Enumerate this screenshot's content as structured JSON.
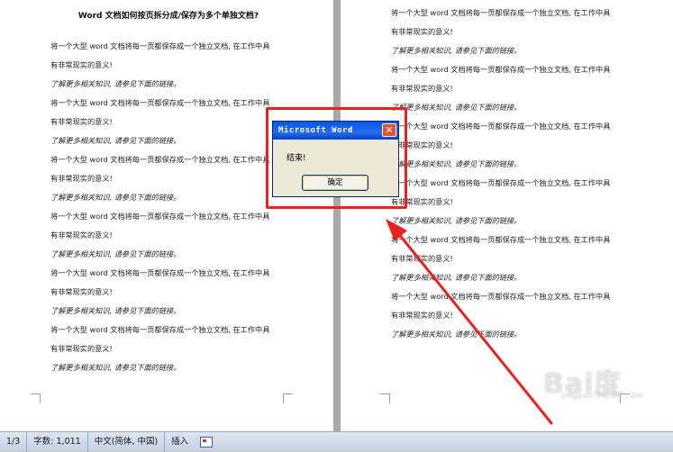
{
  "document": {
    "title": "Word 文档如何按页拆分成/保存为多个单独文档?",
    "para_line1": "将一个大型 word 文档将每一页都保存成一个独立文档, 在工作中具",
    "para_line2": "有非常现实的意义!",
    "link_line": "了解更多相关知识,  请参见下面的链接。"
  },
  "dialog": {
    "title": "Microsoft Word",
    "message": "结束!",
    "ok_label": "确定",
    "close_symbol": "✕"
  },
  "status_bar": {
    "page": "1/3",
    "word_count": "字数: 1,011",
    "language": "中文(简体, 中国)",
    "mode": "插入"
  },
  "watermark": {
    "main": "Bai度",
    "sub": "jingyan.baidu.com"
  },
  "colors": {
    "highlight": "#e8231f",
    "dialog_title": "#0058e6"
  }
}
